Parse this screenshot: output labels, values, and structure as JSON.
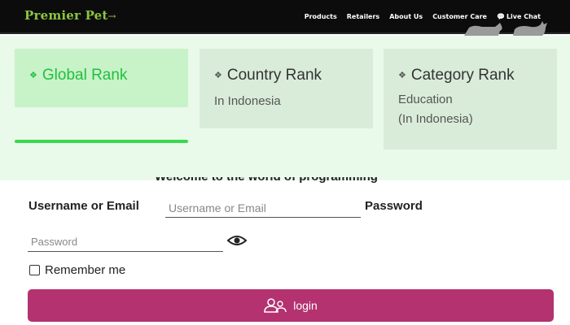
{
  "header": {
    "brand": "Premier Pet",
    "brand_tail": "→",
    "nav": [
      "Products",
      "Retailers",
      "About Us",
      "Customer Care",
      "Live Chat"
    ]
  },
  "ranks": [
    {
      "title": "Global Rank",
      "sub": "",
      "sub2": ""
    },
    {
      "title": "Country Rank",
      "sub": "In Indonesia",
      "sub2": ""
    },
    {
      "title": "Category Rank",
      "sub": "Education",
      "sub2": "(In Indonesia)"
    }
  ],
  "form": {
    "welcome": "Welcome to the world of programming",
    "username_label": "Username or Email",
    "username_placeholder": "Username or Email",
    "password_label": "Password",
    "password_placeholder": "Password",
    "remember_label": "Remember me",
    "login_label": "login"
  },
  "colors": {
    "brand": "#8dc63f",
    "topbar": "#0c0c0c",
    "rank_active": "#22c040",
    "login_button": "#b3326f"
  },
  "icons": [
    "chat-icon",
    "leaf-icon",
    "eye-icon",
    "user-group-icon"
  ]
}
